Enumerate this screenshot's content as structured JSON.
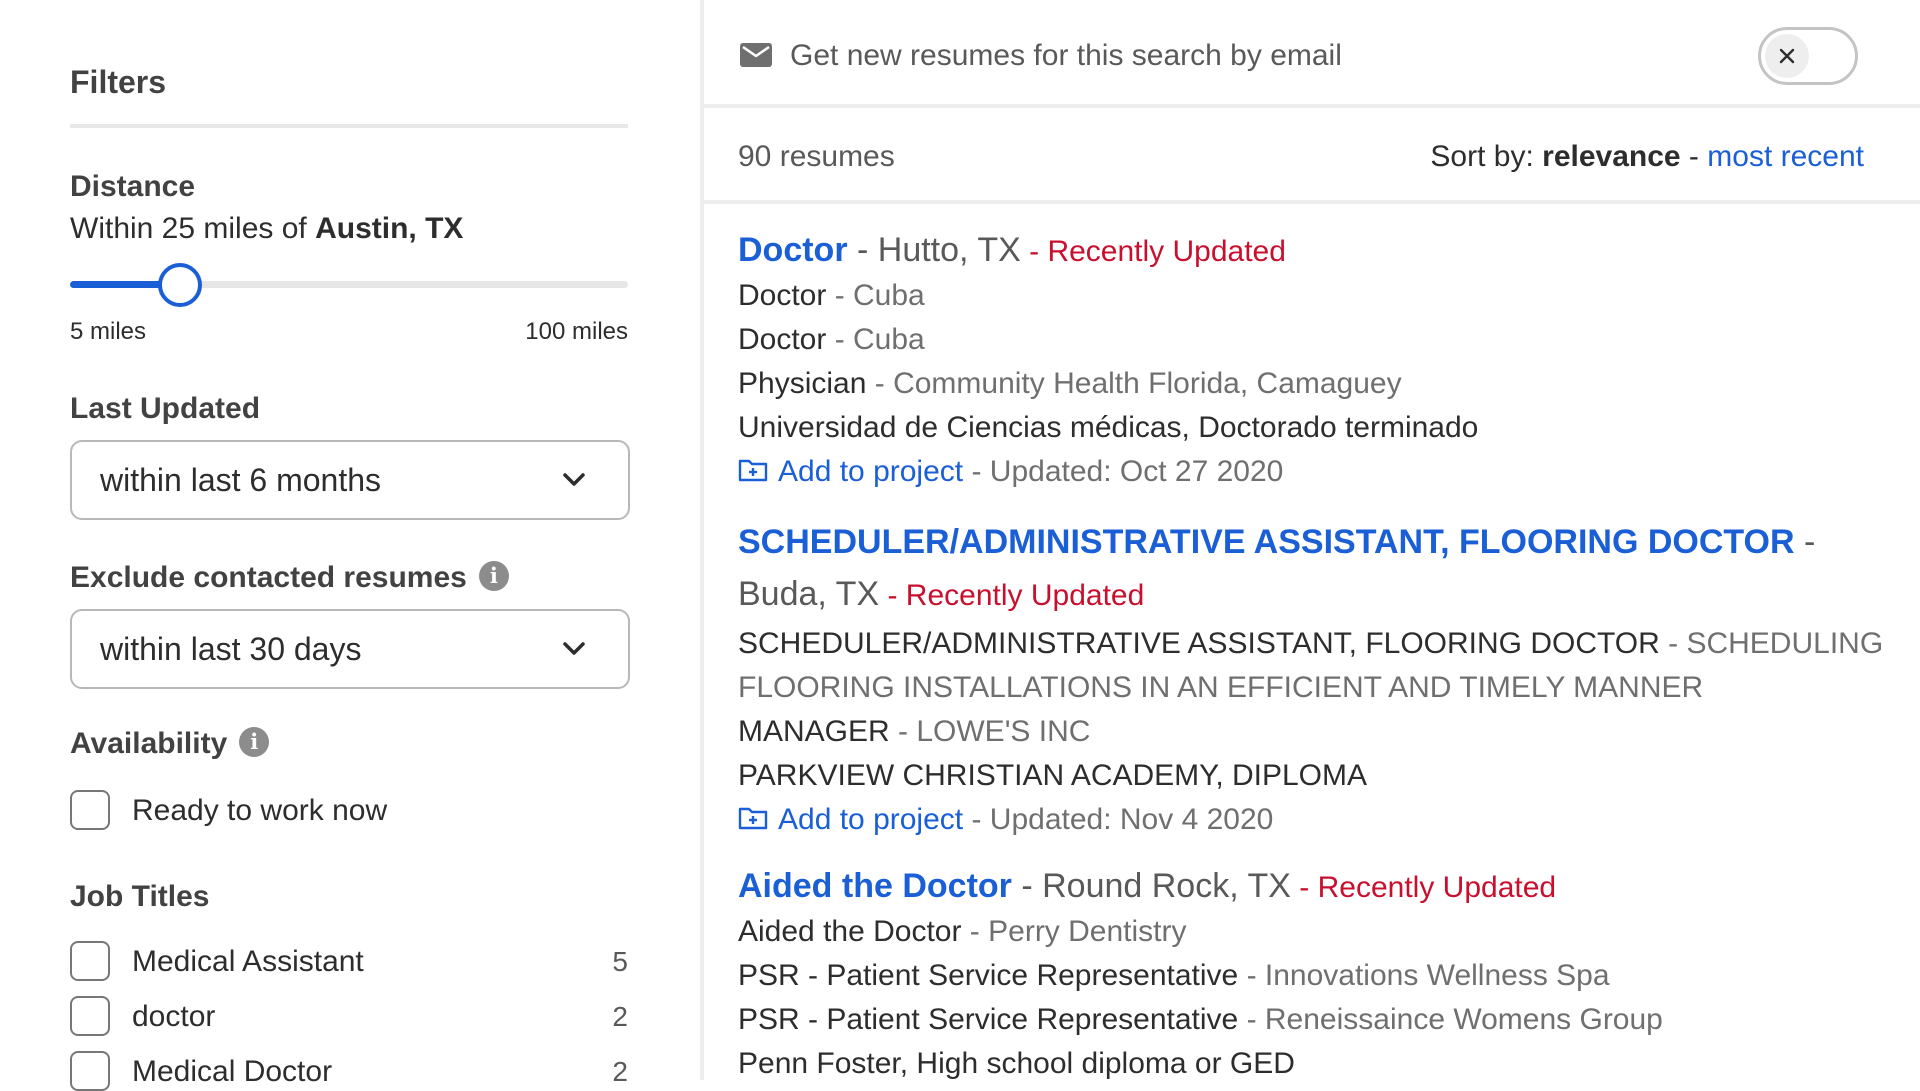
{
  "colors": {
    "link": "#1a5fd6",
    "recent": "#c8102e",
    "muted": "#595959"
  },
  "sidebar": {
    "title": "Filters",
    "distance": {
      "label": "Distance",
      "prefix": "Within 25 miles of",
      "location": "Austin, TX",
      "slider_fraction": 0.19,
      "min_label": "5 miles",
      "max_label": "100 miles"
    },
    "last_updated": {
      "label": "Last Updated",
      "value": "within last 6 months",
      "icon": "chevron-down-icon"
    },
    "exclude_contacted": {
      "label": "Exclude contacted resumes",
      "value": "within last 30 days",
      "icon": "info-icon"
    },
    "availability": {
      "label": "Availability",
      "options": [
        {
          "label": "Ready to work now",
          "checked": false
        }
      ]
    },
    "job_titles": {
      "label": "Job Titles",
      "items": [
        {
          "label": "Medical Assistant",
          "count": "5"
        },
        {
          "label": "doctor",
          "count": "2"
        },
        {
          "label": "Medical Doctor",
          "count": "2"
        }
      ]
    }
  },
  "main": {
    "email_alert": {
      "text": "Get new resumes for this search by email",
      "icon": "mail-icon",
      "toggle_icon": "close-icon"
    },
    "count": "90 resumes",
    "sort": {
      "label": "Sort by:",
      "active": "relevance",
      "separator": " - ",
      "other": "most recent"
    },
    "results": [
      {
        "title": "Doctor",
        "location": " - Hutto, TX",
        "badge": " - Recently Updated",
        "lines": [
          {
            "main": "Doctor",
            "sub": " - Cuba"
          },
          {
            "main": "Doctor",
            "sub": " - Cuba"
          },
          {
            "main": "Physician",
            "sub": " - Community Health Florida, Camaguey"
          },
          {
            "main": "Universidad de Ciencias médicas, Doctorado terminado",
            "sub": ""
          }
        ],
        "add_label": "Add to project",
        "updated": " - Updated: Oct 27 2020"
      },
      {
        "title": "SCHEDULER/ADMINISTRATIVE ASSISTANT, FLOORING DOCTOR",
        "location": " - Buda, TX",
        "badge": " - Recently Updated",
        "lines": [
          {
            "main": "SCHEDULER/ADMINISTRATIVE ASSISTANT, FLOORING DOCTOR",
            "sub": " - SCHEDULING FLOORING INSTALLATIONS IN AN EFFICIENT AND TIMELY MANNER"
          },
          {
            "main": "MANAGER",
            "sub": " - LOWE'S INC"
          },
          {
            "main": "PARKVIEW CHRISTIAN ACADEMY, DIPLOMA",
            "sub": ""
          }
        ],
        "add_label": "Add to project",
        "updated": " - Updated: Nov 4 2020"
      },
      {
        "title": "Aided the Doctor",
        "location": " - Round Rock, TX",
        "badge": " - Recently Updated",
        "lines": [
          {
            "main": "Aided the Doctor",
            "sub": " - Perry Dentistry"
          },
          {
            "main": "PSR - Patient Service Representative",
            "sub": " - Innovations Wellness Spa"
          },
          {
            "main": "PSR - Patient Service Representative",
            "sub": " - Reneissaince Womens Group"
          },
          {
            "main": "Penn Foster, High school diploma or GED",
            "sub": ""
          }
        ],
        "add_label": "",
        "updated": ""
      }
    ]
  }
}
